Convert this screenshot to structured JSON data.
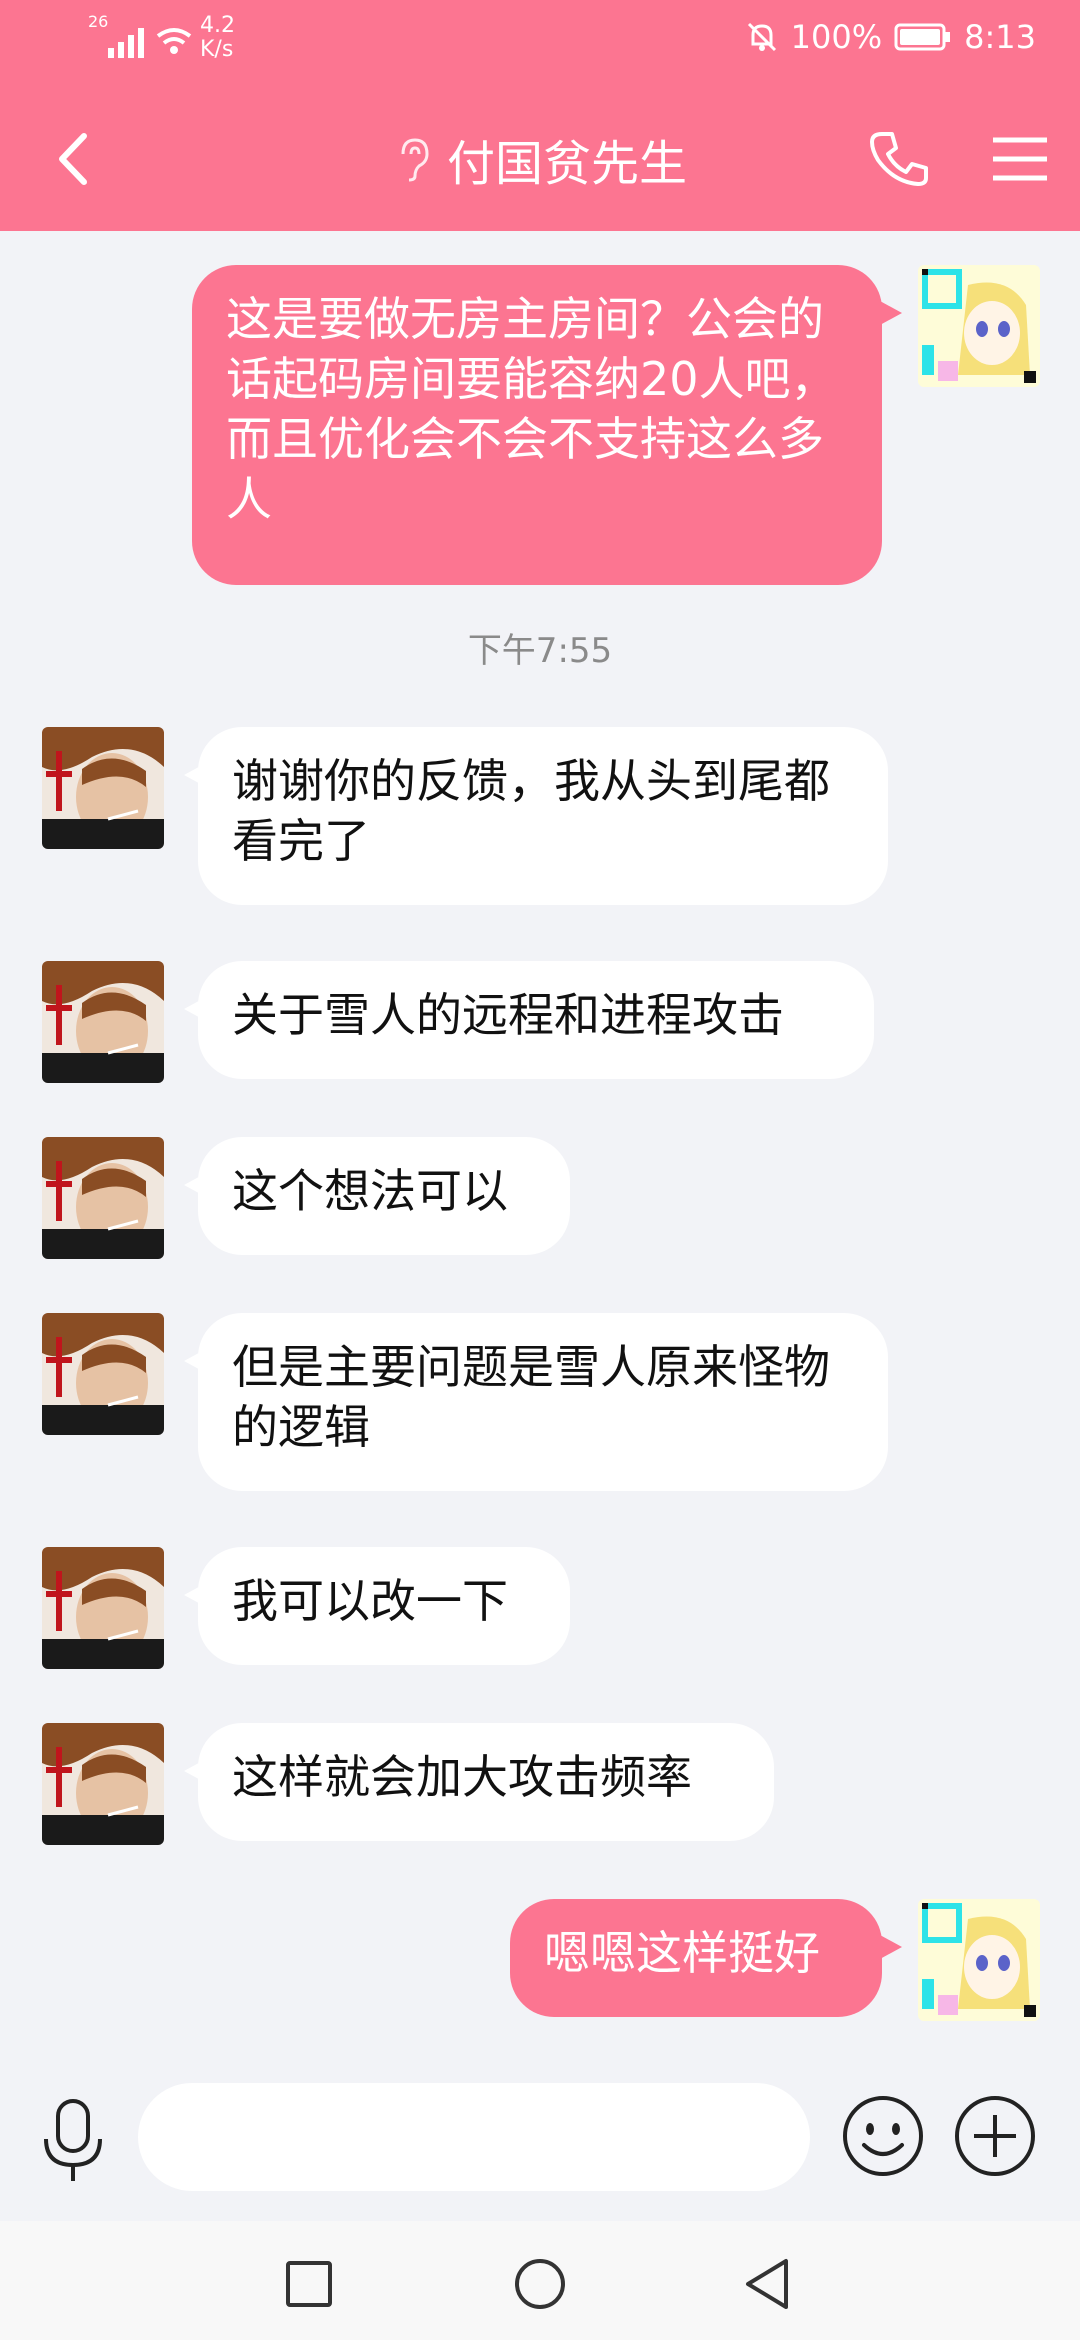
{
  "status_bar": {
    "network": "26",
    "speed_value": "4.2",
    "speed_unit": "K/s",
    "battery": "100%",
    "time": "8:13",
    "icons": [
      "signal-icon",
      "wifi-icon",
      "mute-icon",
      "battery-icon"
    ]
  },
  "header": {
    "title": "付国贫先生",
    "icons": [
      "back-icon",
      "ear-icon",
      "phone-icon",
      "menu-icon"
    ]
  },
  "colors": {
    "accent": "#fc7591",
    "background": "#f2f3f7",
    "bubble_incoming": "#ffffff",
    "timestamp": "#8a8a8a"
  },
  "messages": [
    {
      "side": "out",
      "text": "这是要做无房主房间？公会的话起码房间要能容纳20人吧，而且优化会不会不支持这么多人"
    },
    {
      "timestamp": "下午7:55"
    },
    {
      "side": "in",
      "text": "谢谢你的反馈，我从头到尾都看完了"
    },
    {
      "side": "in",
      "text": "关于雪人的远程和进程攻击"
    },
    {
      "side": "in",
      "text": "这个想法可以"
    },
    {
      "side": "in",
      "text": "但是主要问题是雪人原来怪物的逻辑"
    },
    {
      "side": "in",
      "text": "我可以改一下"
    },
    {
      "side": "in",
      "text": "这样就会加大攻击频率"
    },
    {
      "side": "out",
      "text": "嗯嗯这样挺好"
    }
  ],
  "input_bar": {
    "placeholder": "",
    "icons": [
      "mic-icon",
      "emoji-icon",
      "plus-icon"
    ]
  },
  "system_nav": {
    "icons": [
      "recents-icon",
      "home-icon",
      "back-nav-icon"
    ]
  }
}
